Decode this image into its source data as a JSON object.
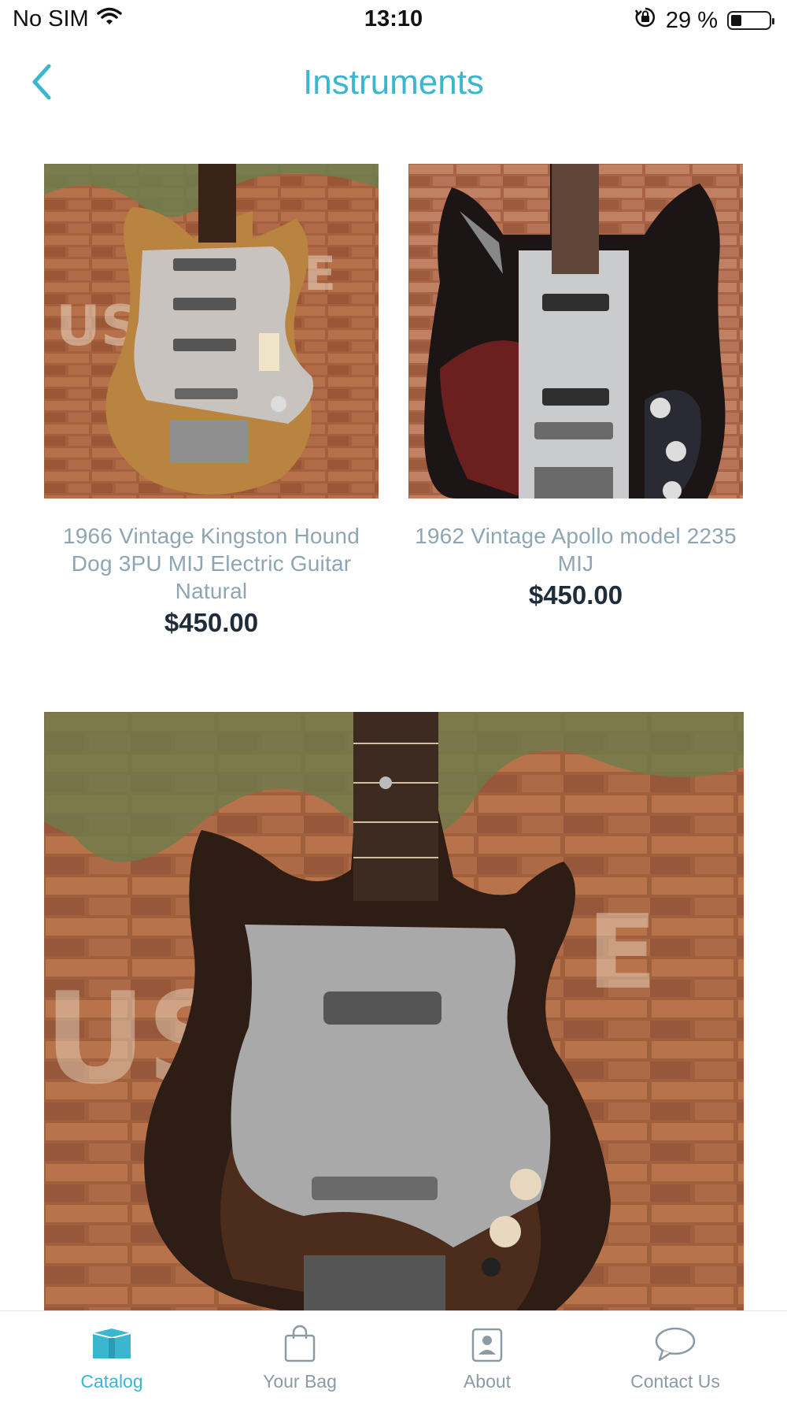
{
  "status_bar": {
    "carrier": "No SIM",
    "time": "13:10",
    "battery_text": "29 %",
    "battery_level": 0.29
  },
  "nav": {
    "title": "Instruments"
  },
  "products": [
    {
      "title": "1966 Vintage Kingston Hound Dog 3PU MIJ Electric Guitar Natural",
      "price": "$450.00"
    },
    {
      "title": "1962 Vintage Apollo model 2235 MIJ",
      "price": "$450.00"
    }
  ],
  "tabs": [
    {
      "label": "Catalog",
      "icon": "box-icon",
      "active": true
    },
    {
      "label": "Your Bag",
      "icon": "shopping-bag-icon",
      "active": false
    },
    {
      "label": "About",
      "icon": "person-card-icon",
      "active": false
    },
    {
      "label": "Contact Us",
      "icon": "chat-bubble-icon",
      "active": false
    }
  ],
  "colors": {
    "accent": "#3ab7cf",
    "title_text": "#8ea6b3",
    "price_text": "#1f2d3a",
    "tab_inactive": "#8c9aa3"
  }
}
